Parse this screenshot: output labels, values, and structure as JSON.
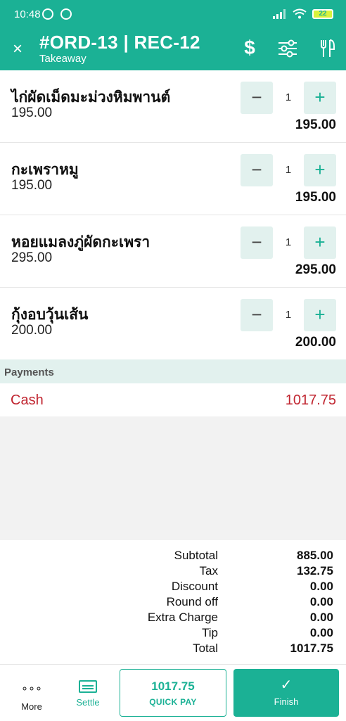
{
  "status_bar": {
    "time": "10:48",
    "battery": "22"
  },
  "header": {
    "close_icon": "×",
    "title": "#ORD-13  | REC-12",
    "subtitle": "Takeaway",
    "icons": [
      "dollar-icon",
      "sliders-icon",
      "utensils-icon"
    ]
  },
  "items": [
    {
      "name": "ไก่ผัดเม็ดมะม่วงหิมพานต์",
      "price": "195.00",
      "qty": "1",
      "total": "195.00"
    },
    {
      "name": "กะเพราหมู",
      "price": "195.00",
      "qty": "1",
      "total": "195.00"
    },
    {
      "name": "หอยแมลงภู่ผัดกะเพรา",
      "price": "295.00",
      "qty": "1",
      "total": "295.00"
    },
    {
      "name": "กุ้งอบวุ้นเส้น",
      "price": "200.00",
      "qty": "1",
      "total": "200.00"
    }
  ],
  "qty_controls": {
    "minus": "−",
    "plus": "+"
  },
  "payments": {
    "header": "Payments",
    "rows": [
      {
        "method": "Cash",
        "amount": "1017.75"
      }
    ]
  },
  "summary": [
    {
      "label": "Subtotal",
      "value": "885.00"
    },
    {
      "label": "Tax",
      "value": "132.75"
    },
    {
      "label": "Discount",
      "value": "0.00"
    },
    {
      "label": "Round off",
      "value": "0.00"
    },
    {
      "label": "Extra Charge",
      "value": "0.00"
    },
    {
      "label": "Tip",
      "value": "0.00"
    },
    {
      "label": "Total",
      "value": "1017.75"
    }
  ],
  "bottom_bar": {
    "more_label": "More",
    "more_icon": "∘∘∘",
    "settle_label": "Settle",
    "quick_pay_amount": "1017.75",
    "quick_pay_label": "QUICK PAY",
    "finish_icon": "✓",
    "finish_label": "Finish"
  },
  "colors": {
    "accent": "#1bb195",
    "light_accent": "#e2f1ee",
    "payment_red": "#c0242f"
  }
}
